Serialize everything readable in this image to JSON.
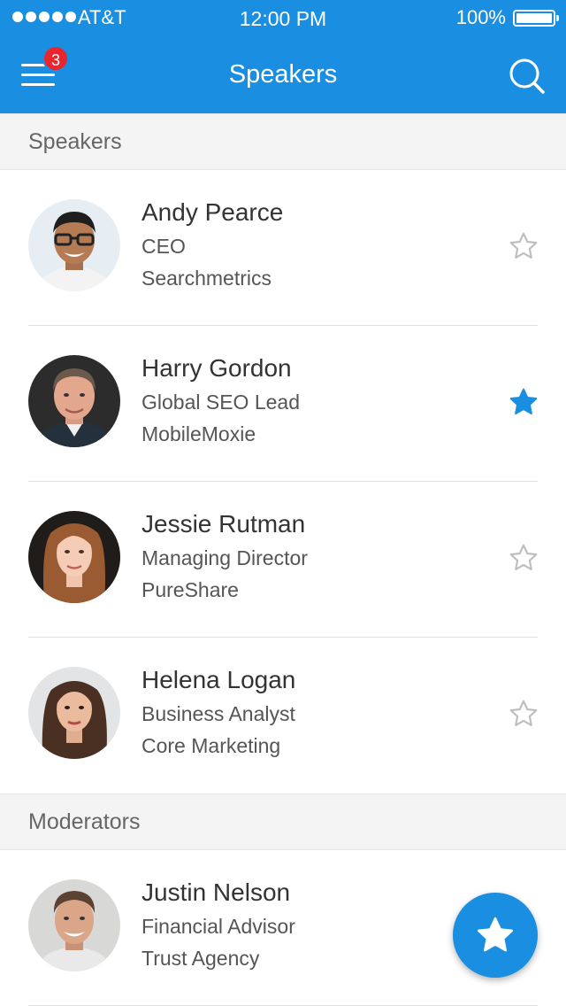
{
  "status_bar": {
    "carrier": "AT&T",
    "time": "12:00 PM",
    "battery": "100%"
  },
  "header": {
    "title": "Speakers",
    "notification_count": "3"
  },
  "sections": [
    {
      "title": "Speakers"
    },
    {
      "title": "Moderators"
    }
  ],
  "people": [
    {
      "name": "Andy Pearce",
      "role": "CEO",
      "company": "Searchmetrics",
      "favorite": false
    },
    {
      "name": "Harry Gordon",
      "role": "Global SEO Lead",
      "company": "MobileMoxie",
      "favorite": true
    },
    {
      "name": "Jessie Rutman",
      "role": "Managing Director",
      "company": "PureShare",
      "favorite": false
    },
    {
      "name": "Helena Logan",
      "role": "Business Analyst",
      "company": "Core Marketing",
      "favorite": false
    },
    {
      "name": "Justin Nelson",
      "role": "Financial Advisor",
      "company": "Trust Agency",
      "favorite": false
    }
  ],
  "colors": {
    "primary": "#1a8ee1",
    "badge": "#e8262d",
    "star_inactive": "#bdbdbd"
  },
  "icons": {
    "menu": "hamburger-icon",
    "search": "search-icon",
    "favorite": "star-icon",
    "fab": "star-icon"
  }
}
